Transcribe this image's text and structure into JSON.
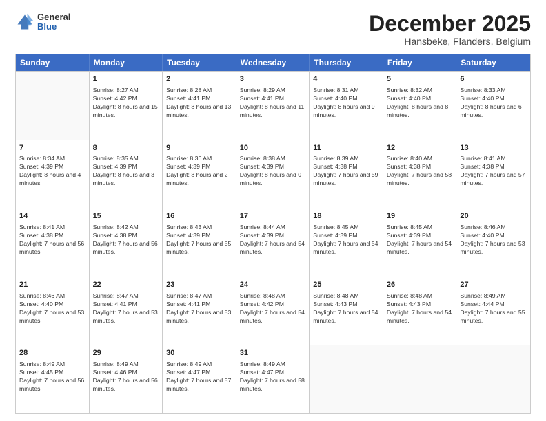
{
  "logo": {
    "general": "General",
    "blue": "Blue"
  },
  "title": "December 2025",
  "subtitle": "Hansbeke, Flanders, Belgium",
  "header_days": [
    "Sunday",
    "Monday",
    "Tuesday",
    "Wednesday",
    "Thursday",
    "Friday",
    "Saturday"
  ],
  "weeks": [
    [
      {
        "day": "",
        "sunrise": "",
        "sunset": "",
        "daylight": "",
        "empty": true
      },
      {
        "day": "1",
        "sunrise": "Sunrise: 8:27 AM",
        "sunset": "Sunset: 4:42 PM",
        "daylight": "Daylight: 8 hours and 15 minutes."
      },
      {
        "day": "2",
        "sunrise": "Sunrise: 8:28 AM",
        "sunset": "Sunset: 4:41 PM",
        "daylight": "Daylight: 8 hours and 13 minutes."
      },
      {
        "day": "3",
        "sunrise": "Sunrise: 8:29 AM",
        "sunset": "Sunset: 4:41 PM",
        "daylight": "Daylight: 8 hours and 11 minutes."
      },
      {
        "day": "4",
        "sunrise": "Sunrise: 8:31 AM",
        "sunset": "Sunset: 4:40 PM",
        "daylight": "Daylight: 8 hours and 9 minutes."
      },
      {
        "day": "5",
        "sunrise": "Sunrise: 8:32 AM",
        "sunset": "Sunset: 4:40 PM",
        "daylight": "Daylight: 8 hours and 8 minutes."
      },
      {
        "day": "6",
        "sunrise": "Sunrise: 8:33 AM",
        "sunset": "Sunset: 4:40 PM",
        "daylight": "Daylight: 8 hours and 6 minutes."
      }
    ],
    [
      {
        "day": "7",
        "sunrise": "Sunrise: 8:34 AM",
        "sunset": "Sunset: 4:39 PM",
        "daylight": "Daylight: 8 hours and 4 minutes."
      },
      {
        "day": "8",
        "sunrise": "Sunrise: 8:35 AM",
        "sunset": "Sunset: 4:39 PM",
        "daylight": "Daylight: 8 hours and 3 minutes."
      },
      {
        "day": "9",
        "sunrise": "Sunrise: 8:36 AM",
        "sunset": "Sunset: 4:39 PM",
        "daylight": "Daylight: 8 hours and 2 minutes."
      },
      {
        "day": "10",
        "sunrise": "Sunrise: 8:38 AM",
        "sunset": "Sunset: 4:39 PM",
        "daylight": "Daylight: 8 hours and 0 minutes."
      },
      {
        "day": "11",
        "sunrise": "Sunrise: 8:39 AM",
        "sunset": "Sunset: 4:38 PM",
        "daylight": "Daylight: 7 hours and 59 minutes."
      },
      {
        "day": "12",
        "sunrise": "Sunrise: 8:40 AM",
        "sunset": "Sunset: 4:38 PM",
        "daylight": "Daylight: 7 hours and 58 minutes."
      },
      {
        "day": "13",
        "sunrise": "Sunrise: 8:41 AM",
        "sunset": "Sunset: 4:38 PM",
        "daylight": "Daylight: 7 hours and 57 minutes."
      }
    ],
    [
      {
        "day": "14",
        "sunrise": "Sunrise: 8:41 AM",
        "sunset": "Sunset: 4:38 PM",
        "daylight": "Daylight: 7 hours and 56 minutes."
      },
      {
        "day": "15",
        "sunrise": "Sunrise: 8:42 AM",
        "sunset": "Sunset: 4:38 PM",
        "daylight": "Daylight: 7 hours and 56 minutes."
      },
      {
        "day": "16",
        "sunrise": "Sunrise: 8:43 AM",
        "sunset": "Sunset: 4:39 PM",
        "daylight": "Daylight: 7 hours and 55 minutes."
      },
      {
        "day": "17",
        "sunrise": "Sunrise: 8:44 AM",
        "sunset": "Sunset: 4:39 PM",
        "daylight": "Daylight: 7 hours and 54 minutes."
      },
      {
        "day": "18",
        "sunrise": "Sunrise: 8:45 AM",
        "sunset": "Sunset: 4:39 PM",
        "daylight": "Daylight: 7 hours and 54 minutes."
      },
      {
        "day": "19",
        "sunrise": "Sunrise: 8:45 AM",
        "sunset": "Sunset: 4:39 PM",
        "daylight": "Daylight: 7 hours and 54 minutes."
      },
      {
        "day": "20",
        "sunrise": "Sunrise: 8:46 AM",
        "sunset": "Sunset: 4:40 PM",
        "daylight": "Daylight: 7 hours and 53 minutes."
      }
    ],
    [
      {
        "day": "21",
        "sunrise": "Sunrise: 8:46 AM",
        "sunset": "Sunset: 4:40 PM",
        "daylight": "Daylight: 7 hours and 53 minutes."
      },
      {
        "day": "22",
        "sunrise": "Sunrise: 8:47 AM",
        "sunset": "Sunset: 4:41 PM",
        "daylight": "Daylight: 7 hours and 53 minutes."
      },
      {
        "day": "23",
        "sunrise": "Sunrise: 8:47 AM",
        "sunset": "Sunset: 4:41 PM",
        "daylight": "Daylight: 7 hours and 53 minutes."
      },
      {
        "day": "24",
        "sunrise": "Sunrise: 8:48 AM",
        "sunset": "Sunset: 4:42 PM",
        "daylight": "Daylight: 7 hours and 54 minutes."
      },
      {
        "day": "25",
        "sunrise": "Sunrise: 8:48 AM",
        "sunset": "Sunset: 4:43 PM",
        "daylight": "Daylight: 7 hours and 54 minutes."
      },
      {
        "day": "26",
        "sunrise": "Sunrise: 8:48 AM",
        "sunset": "Sunset: 4:43 PM",
        "daylight": "Daylight: 7 hours and 54 minutes."
      },
      {
        "day": "27",
        "sunrise": "Sunrise: 8:49 AM",
        "sunset": "Sunset: 4:44 PM",
        "daylight": "Daylight: 7 hours and 55 minutes."
      }
    ],
    [
      {
        "day": "28",
        "sunrise": "Sunrise: 8:49 AM",
        "sunset": "Sunset: 4:45 PM",
        "daylight": "Daylight: 7 hours and 56 minutes."
      },
      {
        "day": "29",
        "sunrise": "Sunrise: 8:49 AM",
        "sunset": "Sunset: 4:46 PM",
        "daylight": "Daylight: 7 hours and 56 minutes."
      },
      {
        "day": "30",
        "sunrise": "Sunrise: 8:49 AM",
        "sunset": "Sunset: 4:47 PM",
        "daylight": "Daylight: 7 hours and 57 minutes."
      },
      {
        "day": "31",
        "sunrise": "Sunrise: 8:49 AM",
        "sunset": "Sunset: 4:47 PM",
        "daylight": "Daylight: 7 hours and 58 minutes."
      },
      {
        "day": "",
        "sunrise": "",
        "sunset": "",
        "daylight": "",
        "empty": true
      },
      {
        "day": "",
        "sunrise": "",
        "sunset": "",
        "daylight": "",
        "empty": true
      },
      {
        "day": "",
        "sunrise": "",
        "sunset": "",
        "daylight": "",
        "empty": true
      }
    ]
  ]
}
